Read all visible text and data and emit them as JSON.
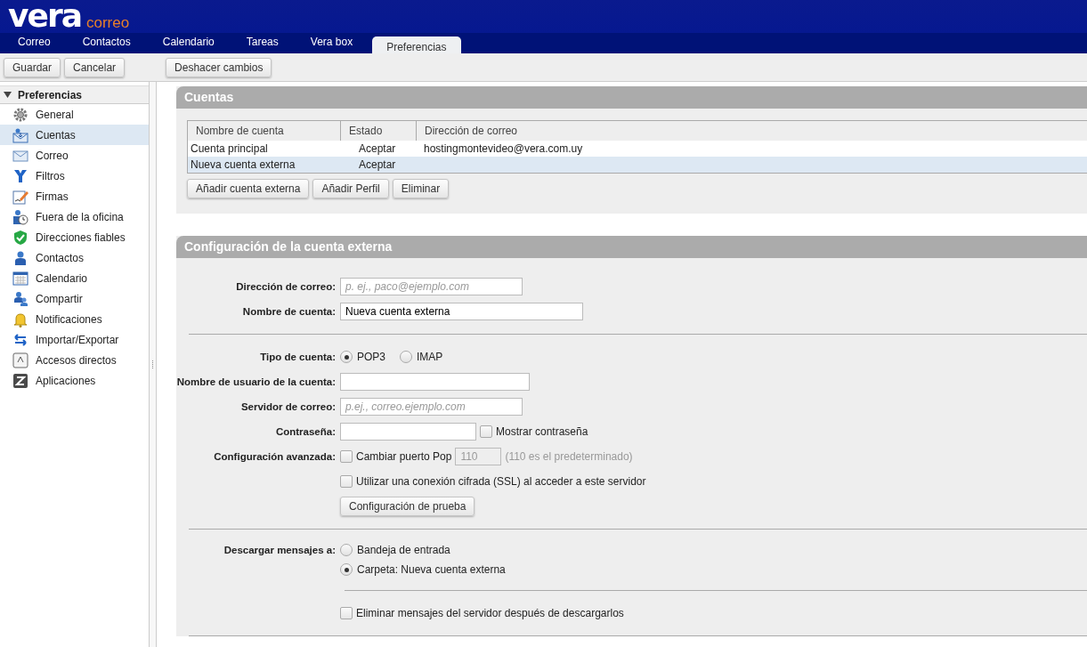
{
  "logo": {
    "brand": "vera",
    "product": "correo"
  },
  "tabs": [
    {
      "label": "Correo",
      "selected": false
    },
    {
      "label": "Contactos",
      "selected": false
    },
    {
      "label": "Calendario",
      "selected": false
    },
    {
      "label": "Tareas",
      "selected": false
    },
    {
      "label": "Vera box",
      "selected": false
    },
    {
      "label": "Preferencias",
      "selected": true
    }
  ],
  "toolbar": {
    "buttons": [
      "Guardar",
      "Cancelar"
    ],
    "undo_button": "Deshacer cambios"
  },
  "sidebar": {
    "title": "Preferencias",
    "expanded": true,
    "items": [
      {
        "label": "General",
        "selected": false
      },
      {
        "label": "Cuentas",
        "selected": true
      },
      {
        "label": "Correo",
        "selected": false
      },
      {
        "label": "Filtros",
        "selected": false
      },
      {
        "label": "Firmas",
        "selected": false
      },
      {
        "label": "Fuera de la oficina",
        "selected": false
      },
      {
        "label": "Direcciones fiables",
        "selected": false
      },
      {
        "label": "Contactos",
        "selected": false
      },
      {
        "label": "Calendario",
        "selected": false
      },
      {
        "label": "Compartir",
        "selected": false
      },
      {
        "label": "Notificaciones",
        "selected": false
      },
      {
        "label": "Importar/Exportar",
        "selected": false
      },
      {
        "label": "Accesos directos",
        "selected": false
      },
      {
        "label": "Aplicaciones",
        "selected": false
      }
    ]
  },
  "accounts": {
    "title": "Cuentas",
    "columns": [
      "Nombre de cuenta",
      "Estado",
      "Dirección de correo"
    ],
    "rows": [
      {
        "cells": [
          "Cuenta principal",
          "Aceptar",
          "hostingmontevideo@vera.com.uy"
        ],
        "selected": false
      },
      {
        "cells": [
          "Nueva cuenta externa",
          "Aceptar",
          ""
        ],
        "selected": true
      }
    ],
    "buttons": [
      "Añadir cuenta externa",
      "Añadir Perfil",
      "Eliminar"
    ]
  },
  "external": {
    "title": "Configuración de la cuenta externa",
    "rows": [
      {
        "kind": "field",
        "label": "Dirección de correo:",
        "placeholder": "p. ej., paco@ejemplo.com"
      },
      {
        "kind": "field",
        "label": "Nombre de cuenta:",
        "value": "Nueva cuenta externa"
      },
      {
        "kind": "divider"
      },
      {
        "kind": "radios",
        "label": "Tipo de cuenta:",
        "options": [
          {
            "label": "POP3",
            "selected": true
          },
          {
            "label": "IMAP",
            "selected": false
          }
        ]
      },
      {
        "kind": "field",
        "label": "Nombre de usuario de la cuenta:",
        "value": ""
      },
      {
        "kind": "field",
        "label": "Servidor de correo:",
        "placeholder": "p.ej., correo.ejemplo.com"
      },
      {
        "kind": "field",
        "label": "Contraseña:",
        "value": "",
        "checkbox": {
          "label": "Mostrar contraseña",
          "checked": false
        }
      },
      {
        "kind": "port",
        "label": "Configuración avanzada:",
        "checkbox": {
          "label": "Cambiar puerto Pop",
          "checked": false
        },
        "value": "110",
        "disabled": true,
        "note": "(110 es el predeterminado)"
      },
      {
        "kind": "checkbox",
        "label": "Utilizar una conexión cifrada (SSL) al acceder a este servidor",
        "checked": false
      },
      {
        "kind": "button",
        "label": "Configuración de prueba"
      },
      {
        "kind": "divider"
      },
      {
        "kind": "radio-list",
        "label": "Descargar mensajes a:",
        "options": [
          {
            "label": "Bandeja de entrada",
            "selected": false
          },
          {
            "label": "Carpeta: Nueva cuenta externa",
            "selected": true
          }
        ]
      },
      {
        "kind": "subdivider"
      },
      {
        "kind": "checkbox",
        "label": "Eliminar mensajes del servidor después de descargarlos",
        "checked": false
      },
      {
        "kind": "divider"
      }
    ]
  }
}
